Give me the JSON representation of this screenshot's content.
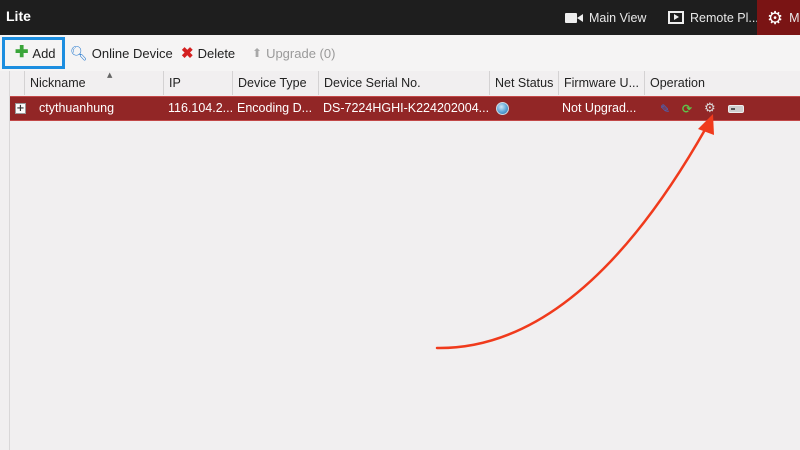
{
  "app": {
    "title": "Lite"
  },
  "nav": {
    "main_view": "Main View",
    "remote_playback": "Remote Pl...",
    "manage": "M"
  },
  "toolbar": {
    "add": "Add",
    "online_device": "Online Device",
    "delete": "Delete",
    "upgrade": "Upgrade (0)"
  },
  "table": {
    "columns": [
      "Nickname",
      "IP",
      "Device Type",
      "Device Serial No.",
      "Net Status",
      "Firmware U...",
      "Operation"
    ],
    "rows": [
      {
        "nickname": "ctythuanhung",
        "ip": "116.104.2...",
        "device_type": "Encoding D...",
        "serial": "DS-7224HGHI-K224202004...",
        "firmware": "Not Upgrad..."
      }
    ]
  },
  "colors": {
    "titlebar": "#1e1e1e",
    "selected_row": "#922626",
    "manage_tab": "#7a1414",
    "add_highlight": "#1c8ee0",
    "annotation_arrow": "#f03a1c"
  }
}
